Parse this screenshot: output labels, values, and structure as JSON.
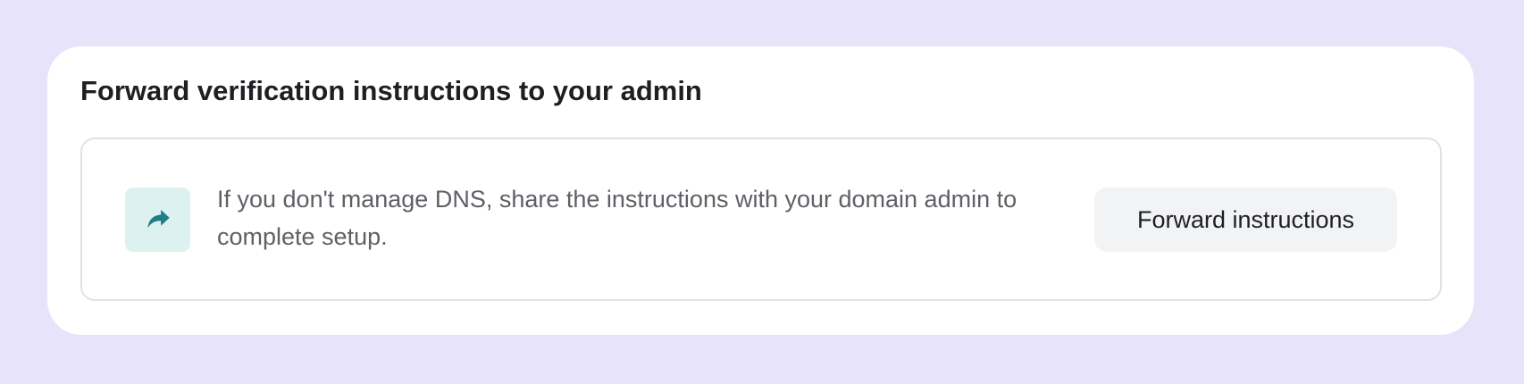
{
  "card": {
    "title": "Forward verification instructions to your admin"
  },
  "panel": {
    "icon": "forward-arrow-icon",
    "description": "If you don't manage DNS, share the instructions with your domain admin to complete setup.",
    "button_label": "Forward instructions"
  },
  "colors": {
    "page_background": "#e6e3fa",
    "card_background": "#ffffff",
    "icon_tile_background": "#ddf1f1",
    "icon_color": "#1f7f85",
    "button_background": "#f2f3f5"
  }
}
